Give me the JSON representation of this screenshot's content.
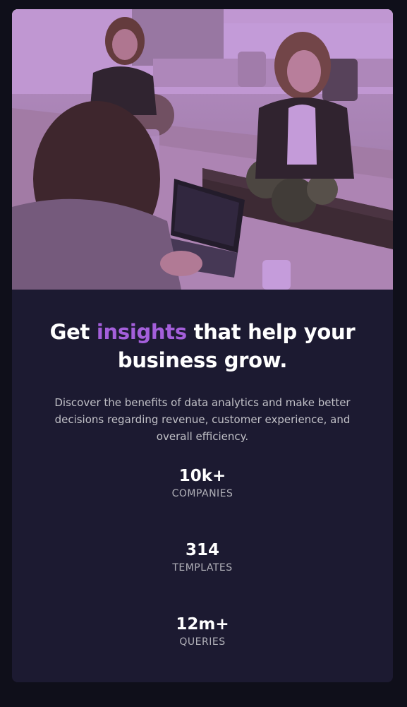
{
  "headline": {
    "before": "Get ",
    "accent": "insights",
    "after": " that help your business grow."
  },
  "description": "Discover the benefits of data analytics and make better decisions regarding revenue, customer experience, and overall efficiency.",
  "stats": [
    {
      "value": "10k+",
      "label": "COMPANIES"
    },
    {
      "value": "314",
      "label": "TEMPLATES"
    },
    {
      "value": "12m+",
      "label": "QUERIES"
    }
  ],
  "colors": {
    "page_background": "#0f0f1a",
    "card_background": "#1c1a31",
    "accent": "#a45fdb",
    "image_overlay": "#aa5cdb"
  },
  "hero_image": {
    "icon": "office-team-photo"
  }
}
